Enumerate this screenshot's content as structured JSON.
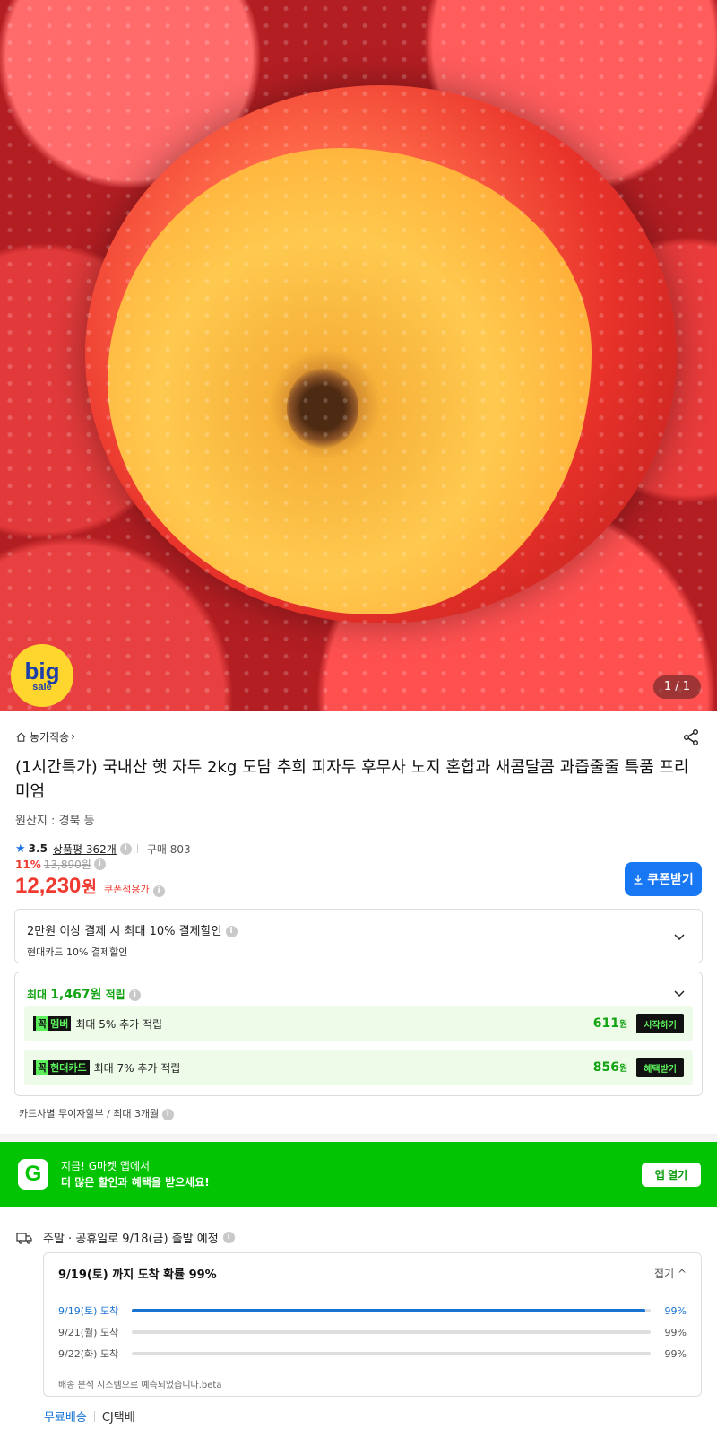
{
  "hero": {
    "badge_line1": "big",
    "badge_line2": "sale",
    "counter": "1 / 1"
  },
  "product": {
    "breadcrumb": "농가직송",
    "title": "(1시간특가) 국내산 햇 자두 2kg 도담 추희 피자두 후무사 노지 혼합과 새콤달콤 과즙줄줄 특품 프리미엄",
    "origin": "원산지 : 경북 등",
    "rating_score": "3.5",
    "review_label": "상품평 362개",
    "purchase_label": "구매 803"
  },
  "price": {
    "discount_pct": "11%",
    "original_price": "13,890원",
    "sale_price": "12,230",
    "currency": "원",
    "coupon_applied_label": "쿠폰적용가",
    "coupon_button": "쿠폰받기",
    "accent_color": "#f0392f"
  },
  "payment_discount": {
    "line1": "2만원 이상 결제 시 최대 10% 결제할인",
    "line2": "현대카드 10% 결제할인"
  },
  "rewards": {
    "header_prefix": "최대 ",
    "header_amount": "1,467원",
    "header_suffix": " 적립",
    "items": [
      {
        "tag_k": "꼭",
        "tag": "멤버",
        "desc": "최대 5% 추가 적립",
        "points": "611",
        "unit": "원",
        "button": "시작하기"
      },
      {
        "tag_k": "꼭",
        "tag": "현대카드",
        "desc": "최대 7% 추가 적립",
        "points": "856",
        "unit": "원",
        "button": "혜택받기"
      }
    ],
    "installment": "카드사별 무이자할부 / 최대 3개월"
  },
  "app_banner": {
    "logo": "G",
    "line1": "지금! G마켓 앱에서",
    "line2": "더 많은 할인과 혜택을 받으세요!",
    "button": "앱 열기",
    "bg_color": "#02c402"
  },
  "shipping": {
    "departure": "주말 · 공휴일로 9/18(금) 출발 예정",
    "summary": "9/19(토) 까지 도착 확률 99%",
    "fold_label": "접기",
    "rows": [
      {
        "label": "9/19(토) 도착",
        "value": "99%",
        "fill": 0.99
      },
      {
        "label": "9/21(월) 도착",
        "value": "99%",
        "fill": 0
      },
      {
        "label": "9/22(화) 도착",
        "value": "99%",
        "fill": 0
      }
    ],
    "note": "배송 분석 시스템으로 예측되었습니다.beta",
    "free_label": "무료배송",
    "carrier": "CJ택배"
  }
}
